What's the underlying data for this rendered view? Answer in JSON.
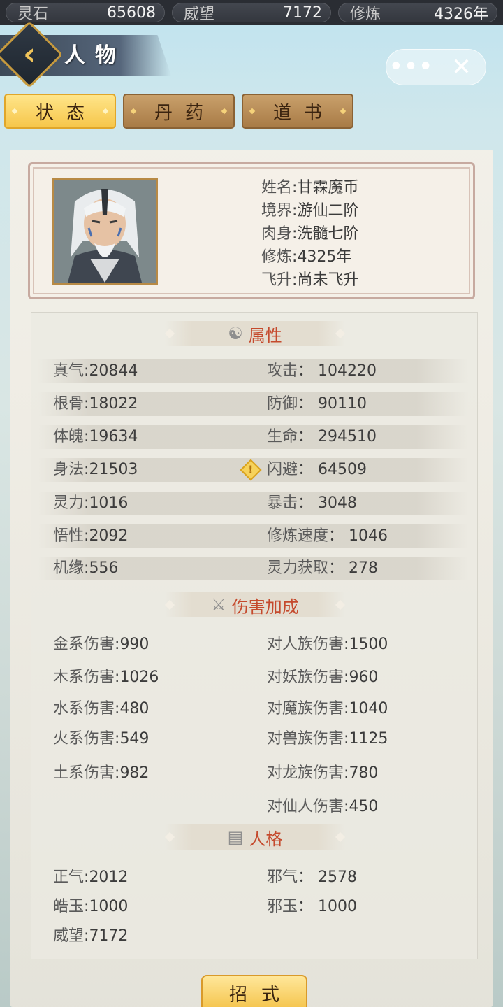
{
  "resources": [
    {
      "label": "灵石",
      "value": "65608"
    },
    {
      "label": "威望",
      "value": "7172"
    },
    {
      "label": "修炼",
      "value": "4326年"
    }
  ],
  "header": {
    "title": "人物",
    "more_glyph": "•••",
    "close_glyph": "✕"
  },
  "tabs": [
    {
      "label": "状态",
      "active": true
    },
    {
      "label": "丹药",
      "active": false
    },
    {
      "label": "道书",
      "active": false
    }
  ],
  "profile": {
    "rows": [
      {
        "key": "姓名",
        "value": "甘霖魔币"
      },
      {
        "key": "境界",
        "value": "游仙二阶"
      },
      {
        "key": "肉身",
        "value": "洗髓七阶"
      },
      {
        "key": "修炼",
        "value": "4325年"
      },
      {
        "key": "飞升",
        "value": "尚未飞升"
      }
    ]
  },
  "sections": {
    "attributes": {
      "title": "属性",
      "icon": "yin-yang-icon",
      "rows": [
        {
          "left": {
            "key": "真气",
            "value": "20844"
          },
          "right": {
            "key": "攻击",
            "value": "104220"
          }
        },
        {
          "left": {
            "key": "根骨",
            "value": "18022"
          },
          "right": {
            "key": "防御",
            "value": "90110"
          }
        },
        {
          "left": {
            "key": "体魄",
            "value": "19634"
          },
          "right": {
            "key": "生命",
            "value": "294510"
          }
        },
        {
          "left": {
            "key": "身法",
            "value": "21503"
          },
          "right": {
            "key": "闪避",
            "value": "64509"
          }
        },
        {
          "left": {
            "key": "灵力",
            "value": "1016"
          },
          "right": {
            "key": "暴击",
            "value": "3048"
          }
        },
        {
          "left": {
            "key": "悟性",
            "value": "2092"
          },
          "right": {
            "key": "修炼速度",
            "value": "1046"
          }
        },
        {
          "left": {
            "key": "机缘",
            "value": "556"
          },
          "right": {
            "key": "灵力获取",
            "value": "278"
          }
        }
      ]
    },
    "damage": {
      "title": "伤害加成",
      "icon": "crossed-swords-icon",
      "rows": [
        {
          "left": {
            "key": "金系伤害",
            "value": "990"
          },
          "right": {
            "key": "对人族伤害",
            "value": "1500"
          }
        },
        {
          "left": {
            "key": "木系伤害",
            "value": "1026"
          },
          "right": {
            "key": "对妖族伤害",
            "value": "960"
          }
        },
        {
          "left": {
            "key": "水系伤害",
            "value": "480"
          },
          "right": {
            "key": "对魔族伤害",
            "value": "1040"
          }
        },
        {
          "left": {
            "key": "火系伤害",
            "value": "549"
          },
          "right": {
            "key": "对兽族伤害",
            "value": "1125"
          }
        },
        {
          "left": {
            "key": "土系伤害",
            "value": "982"
          },
          "right": {
            "key": "对龙族伤害",
            "value": "780"
          }
        },
        {
          "right": {
            "key": "对仙人伤害",
            "value": "450"
          }
        }
      ]
    },
    "personality": {
      "title": "人格",
      "icon": "document-icon",
      "rows": [
        {
          "left": {
            "key": "正气",
            "value": "2012"
          },
          "right": {
            "key": "邪气",
            "value": "2578"
          }
        },
        {
          "left": {
            "key": "皓玉",
            "value": "1000"
          },
          "right": {
            "key": "邪玉",
            "value": "1000"
          }
        },
        {
          "left": {
            "key": "威望",
            "value": "7172"
          }
        }
      ]
    }
  },
  "bottom_button": {
    "label": "招式"
  },
  "colors": {
    "accent_gold": "#f6c64a",
    "section_title_red": "#c54a2d",
    "topbar_dark": "#2a2d33"
  }
}
